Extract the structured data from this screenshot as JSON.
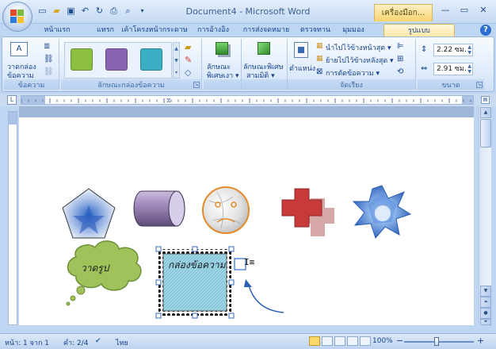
{
  "window": {
    "title": "Document4 - Microsoft Word",
    "context_tab": "เครื่องมือก...",
    "minimize": "—",
    "maximize": "▭",
    "close": "✕"
  },
  "qat": [
    "save-icon",
    "undo-icon",
    "redo-icon",
    "print-icon",
    "preview-icon"
  ],
  "tabs": [
    {
      "label": "หน้าแรก"
    },
    {
      "label": "แทรก"
    },
    {
      "label": "เค้าโครงหน้ากระดาษ"
    },
    {
      "label": "การอ้างอิง"
    },
    {
      "label": "การส่งจดหมาย"
    },
    {
      "label": "ตรวจทาน"
    },
    {
      "label": "มุมมอง"
    },
    {
      "label": "รูปแบบ",
      "active": true
    }
  ],
  "ribbon": {
    "groups": {
      "text": {
        "label": "ข้อความ",
        "draw_textbox": "วาดกล่อง",
        "draw_textbox_2": "ข้อความ"
      },
      "styles": {
        "label": "ลักษณะกล่องข้อความ",
        "swatch_colors": [
          "#8cbf3f",
          "#8a63b5",
          "#3aaec3"
        ]
      },
      "shadow": {
        "label": "",
        "shadow_effects_1": "ลักษณะ",
        "shadow_effects_2": "พิเศษเงา ▾"
      },
      "threed": {
        "label": "",
        "threed_effects_1": "ลักษณะพิเศษ",
        "threed_effects_2": "สามมิติ ▾"
      },
      "arrange": {
        "label": "จัดเรียง",
        "position": "ตำแหน่ง",
        "bring_front": "นำไปไว้ข้างหน้าสุด ▾",
        "send_back": "ย้ายไปไว้ข้างหลังสุด ▾",
        "wrap": "การตัดข้อความ ▾"
      },
      "size": {
        "label": "ขนาด",
        "height": "2.22 ซม.",
        "width": "2.91 ซม."
      }
    }
  },
  "document": {
    "cloud_text": "วาดรูป",
    "textbox_text": "กล่องข้อความ"
  },
  "status": {
    "page": "หน้า: 1 จาก 1",
    "words": "คำ: 2/4",
    "language": "ไทย",
    "zoom": "100%",
    "zoom_minus": "−",
    "zoom_plus": "+"
  }
}
